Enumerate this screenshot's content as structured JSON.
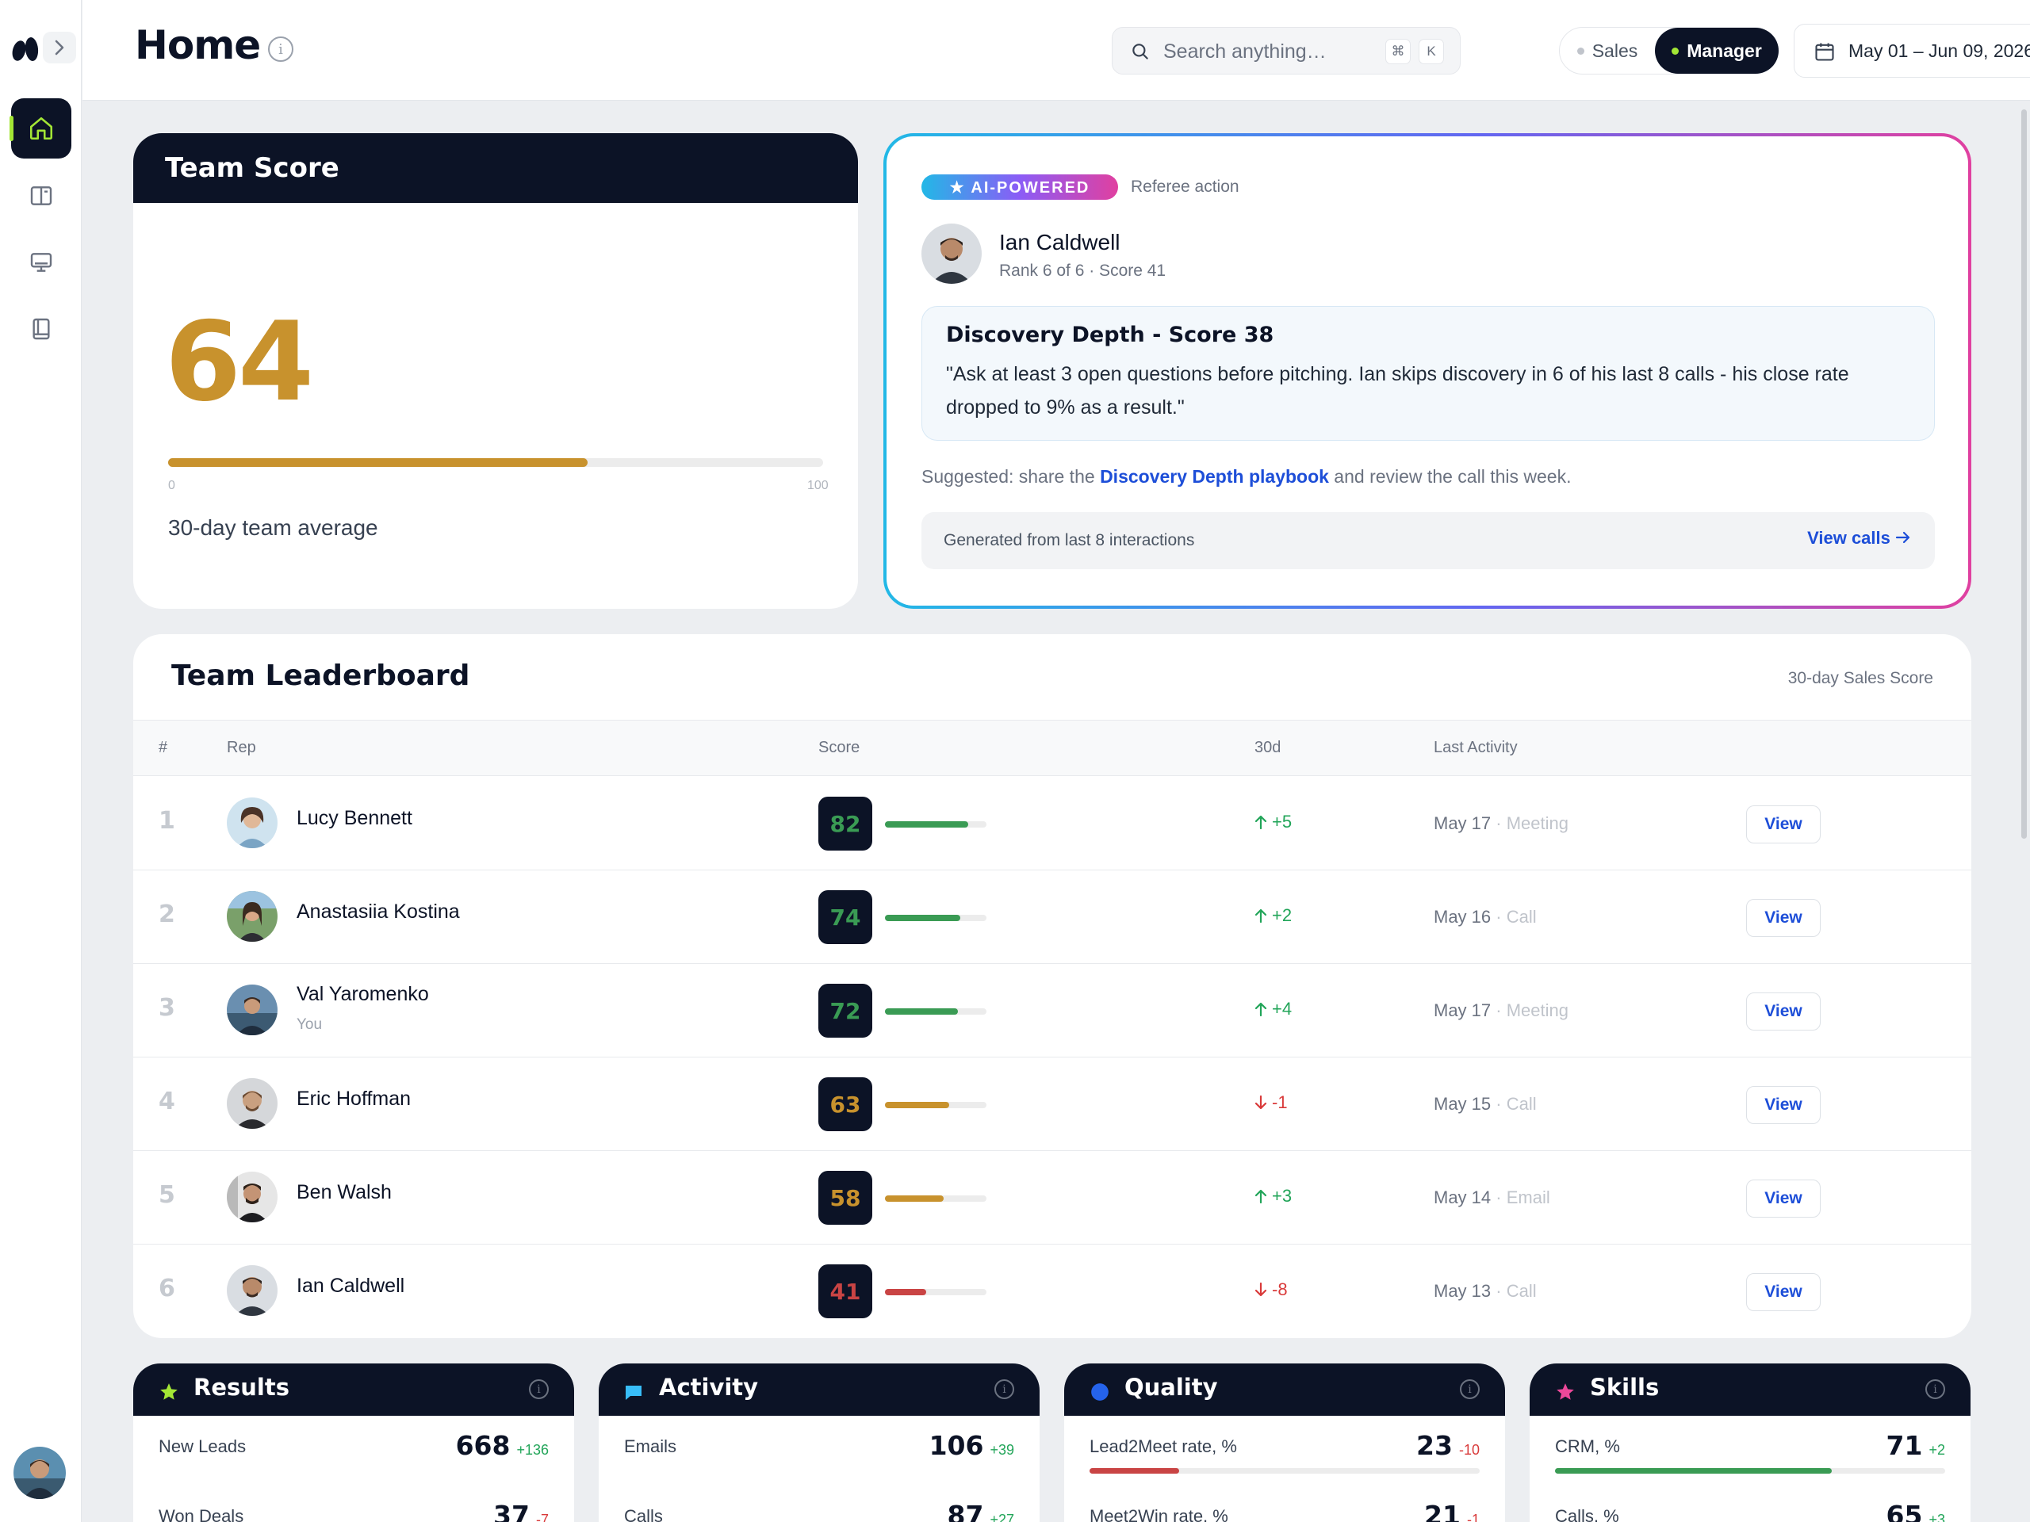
{
  "header": {
    "title": "Home",
    "search_placeholder": "Search anything…",
    "kbd_cmd": "⌘",
    "kbd_k": "K",
    "mode_options": [
      "Sales",
      "Manager"
    ],
    "mode_selected": "Manager",
    "date_range": "May 01 – Jun 09, 2026"
  },
  "sidebar": {
    "items": [
      {
        "name": "home-icon",
        "active": true
      },
      {
        "name": "book-open-icon",
        "active": false
      },
      {
        "name": "monitor-icon",
        "active": false
      },
      {
        "name": "notebook-icon",
        "active": false
      }
    ]
  },
  "team_score": {
    "title": "Team Score",
    "value": "64",
    "progress_percent": 64,
    "min": "0",
    "max": "100",
    "caption": "30-day team average"
  },
  "ai_card": {
    "badge": "★ AI-POWERED",
    "kind": "Referee action",
    "person": {
      "name": "Ian Caldwell",
      "meta": "Rank 6 of 6 · Score 41"
    },
    "insight_title": "Discovery Depth - Score 38",
    "insight_quote": "\"Ask at least 3 open questions before pitching. Ian skips discovery in 6 of his last 8 calls - his close rate dropped to 9% as a result.\"",
    "suggest_prefix": "Suggested: share the ",
    "suggest_link": "Discovery Depth playbook",
    "suggest_suffix": " and review the call this week.",
    "generated": "Generated from last 8 interactions",
    "view_calls": "View calls"
  },
  "leaderboard": {
    "title": "Team Leaderboard",
    "subtitle": "30-day Sales Score",
    "columns": [
      "#",
      "Rep",
      "Score",
      "30d",
      "Last Activity"
    ],
    "view_label": "View",
    "rows": [
      {
        "rank": "1",
        "name": "Lucy Bennett",
        "you": "",
        "score": "82",
        "score_pct": 82,
        "tier": "green",
        "delta": "+5",
        "dir": "up",
        "date": "May 17",
        "type": "Meeting"
      },
      {
        "rank": "2",
        "name": "Anastasiia Kostina",
        "you": "",
        "score": "74",
        "score_pct": 74,
        "tier": "green",
        "delta": "+2",
        "dir": "up",
        "date": "May 16",
        "type": "Call"
      },
      {
        "rank": "3",
        "name": "Val Yaromenko",
        "you": "You",
        "score": "72",
        "score_pct": 72,
        "tier": "green",
        "delta": "+4",
        "dir": "up",
        "date": "May 17",
        "type": "Meeting"
      },
      {
        "rank": "4",
        "name": "Eric Hoffman",
        "you": "",
        "score": "63",
        "score_pct": 63,
        "tier": "amber",
        "delta": "-1",
        "dir": "down",
        "date": "May 15",
        "type": "Call"
      },
      {
        "rank": "5",
        "name": "Ben Walsh",
        "you": "",
        "score": "58",
        "score_pct": 58,
        "tier": "amber",
        "delta": "+3",
        "dir": "up",
        "date": "May 14",
        "type": "Email"
      },
      {
        "rank": "6",
        "name": "Ian Caldwell",
        "you": "",
        "score": "41",
        "score_pct": 41,
        "tier": "red",
        "delta": "-8",
        "dir": "down",
        "date": "May 13",
        "type": "Call"
      }
    ]
  },
  "metrics": [
    {
      "title": "Results",
      "icon": "star-icon",
      "color": "#a3e635",
      "rows": [
        {
          "label": "New Leads",
          "value": "668",
          "change": "+136",
          "dir": "up"
        },
        {
          "label": "Won Deals",
          "value": "37",
          "change": "-7",
          "dir": "down"
        }
      ]
    },
    {
      "title": "Activity",
      "icon": "chat-icon",
      "color": "#38bdf8",
      "rows": [
        {
          "label": "Emails",
          "value": "106",
          "change": "+39",
          "dir": "up"
        },
        {
          "label": "Calls",
          "value": "87",
          "change": "+27",
          "dir": "up"
        }
      ]
    },
    {
      "title": "Quality",
      "icon": "circle-icon",
      "color": "#2563eb",
      "rows": [
        {
          "label": "Lead2Meet rate, %",
          "value": "23",
          "change": "-10",
          "dir": "down",
          "bar": 23
        },
        {
          "label": "Meet2Win rate, %",
          "value": "21",
          "change": "-1",
          "dir": "down",
          "bar": 21
        }
      ]
    },
    {
      "title": "Skills",
      "icon": "star-icon",
      "color": "#ec4899",
      "rows": [
        {
          "label": "CRM, %",
          "value": "71",
          "change": "+2",
          "dir": "up",
          "bar": 71
        },
        {
          "label": "Calls, %",
          "value": "65",
          "change": "+3",
          "dir": "up",
          "bar": 65
        }
      ]
    }
  ],
  "colors": {
    "navy": "#0c1326",
    "gold": "#c8922d",
    "green": "#3a9b54",
    "red": "#c94444",
    "up": "#22a559",
    "down": "#d93a3a",
    "link": "#1d4ed8"
  }
}
